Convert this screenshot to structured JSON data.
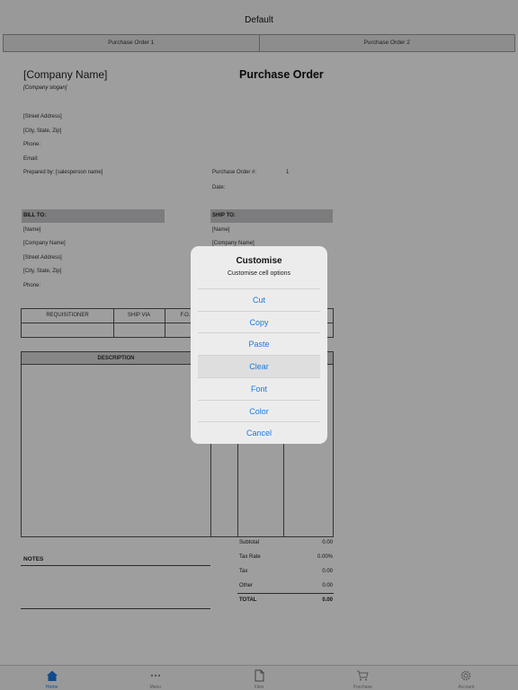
{
  "nav": {
    "title": "Default"
  },
  "sheet_tabs": [
    "Purchase Order 1",
    "Purchase Order 2"
  ],
  "document": {
    "company_name": "[Company Name]",
    "title": "Purchase Order",
    "slogan": "[Company slogan]",
    "address_lines": [
      "[Street Address]",
      "[City, State,  Zip]",
      "Phone:",
      "Email:"
    ],
    "prepared_by": "Prepared by: [salesperson name]",
    "po_number_label": "Purchase Order #:",
    "po_number_value": "1",
    "date_label": "Date:",
    "bill_to": {
      "label": "BILL TO:",
      "lines": [
        "[Name]",
        "[Company Name]",
        "[Street Address]",
        "[City, State,  Zip]",
        "Phone:"
      ]
    },
    "ship_to": {
      "label": "SHIP TO:",
      "lines": [
        "[Name]",
        "[Company Name]"
      ]
    },
    "order_table_headers": [
      "REQUISITIONER",
      "SHIP VIA",
      "F.O."
    ],
    "items_header": "DESCRIPTION",
    "totals": [
      {
        "label": "Subtotal",
        "value": "0.00"
      },
      {
        "label": "Tax Rate",
        "value": "0.00%"
      },
      {
        "label": "Tax",
        "value": "0.00"
      },
      {
        "label": "Other",
        "value": "0.00"
      },
      {
        "label": "TOTAL",
        "value": "0.00"
      }
    ],
    "notes_label": "NOTES"
  },
  "dialog": {
    "title": "Customise",
    "message": "Customise cell options",
    "options": [
      "Cut",
      "Copy",
      "Paste",
      "Clear",
      "Font",
      "Color",
      "Cancel"
    ],
    "highlighted_option": "Clear",
    "accent_color": "#1a7ae0"
  },
  "tabbar": {
    "items": [
      {
        "label": "Home",
        "icon": "home-icon",
        "active": true
      },
      {
        "label": "Menu",
        "icon": "ellipsis-icon",
        "active": false
      },
      {
        "label": "Files",
        "icon": "file-icon",
        "active": false
      },
      {
        "label": "Purchase",
        "icon": "cart-icon",
        "active": false
      },
      {
        "label": "Account",
        "icon": "gear-icon",
        "active": false
      }
    ]
  }
}
